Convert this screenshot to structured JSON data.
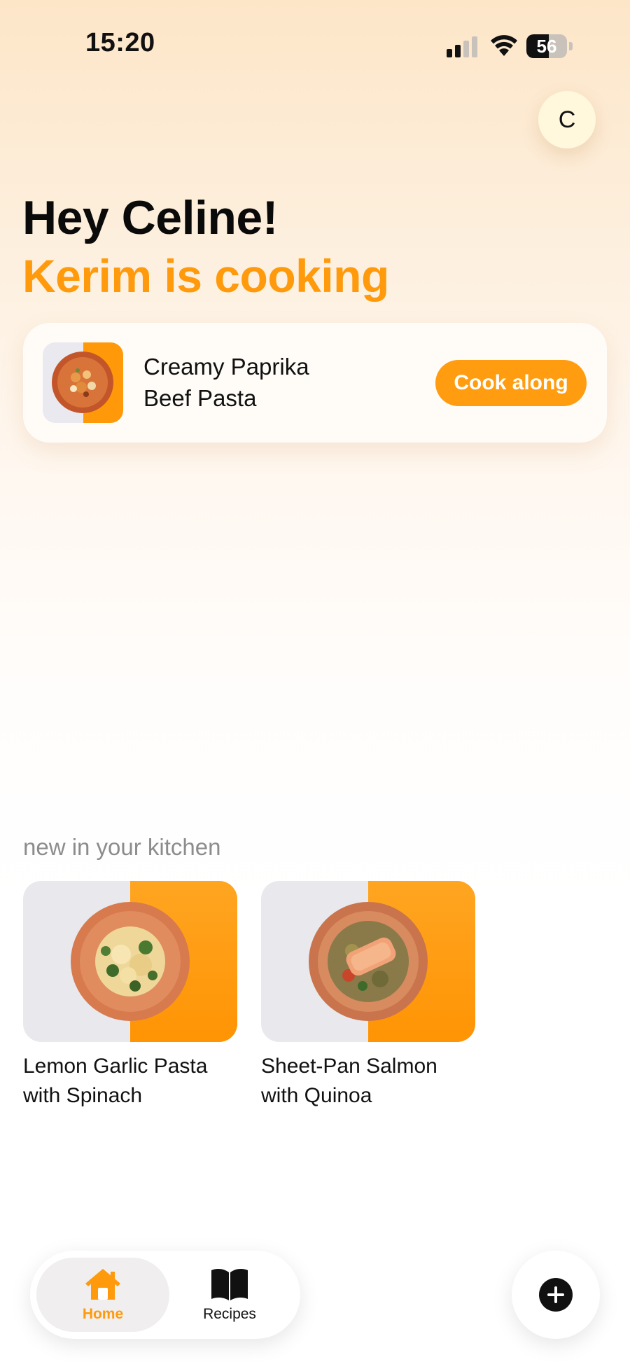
{
  "status_bar": {
    "time": "15:20",
    "battery_level": "56",
    "icons": [
      "signal-icon",
      "wifi-icon",
      "battery-icon"
    ]
  },
  "profile": {
    "avatar_initial": "C"
  },
  "header": {
    "greeting": "Hey Celine!",
    "subheading": "Kerim is cooking"
  },
  "cooking_card": {
    "recipe_title_line1": "Creamy Paprika",
    "recipe_title_line2": "Beef Pasta",
    "action_label": "Cook along"
  },
  "new_section": {
    "title": "new in your kitchen",
    "recipes": [
      {
        "title_line1": "Lemon Garlic Pasta",
        "title_line2": "with Spinach"
      },
      {
        "title_line1": "Sheet-Pan Salmon",
        "title_line2": "with Quinoa"
      }
    ]
  },
  "tab_bar": {
    "tabs": [
      {
        "label": "Home",
        "icon": "home-icon",
        "active": true
      },
      {
        "label": "Recipes",
        "icon": "book-icon",
        "active": false
      }
    ],
    "add_icon": "plus-icon"
  },
  "colors": {
    "accent": "#ff9a0c",
    "background_top": "#fde6c8",
    "text": "#111111",
    "muted": "#8c8c8c"
  }
}
